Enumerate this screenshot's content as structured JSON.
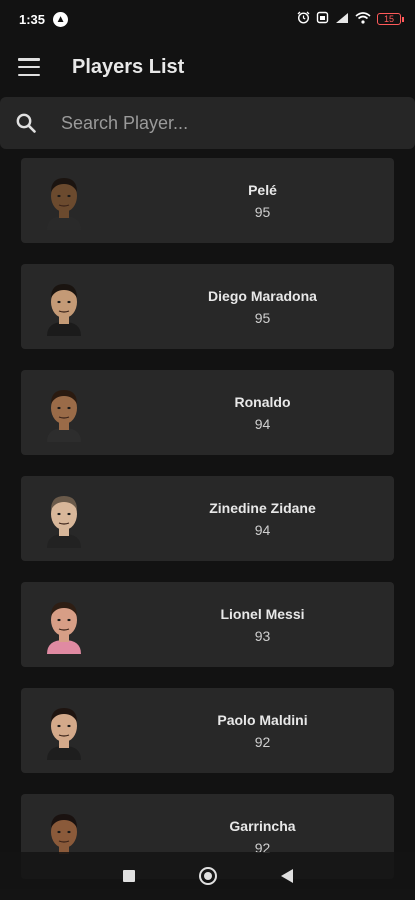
{
  "status_bar": {
    "time": "1:35",
    "battery": "15",
    "battery_color": "#ff5a5a"
  },
  "app_bar": {
    "title": "Players List",
    "menu_icon": "hamburger-menu-icon"
  },
  "search": {
    "placeholder": "Search Player...",
    "value": ""
  },
  "players": [
    {
      "name": "Pelé",
      "rating": "95",
      "skin": "#6b4a2e",
      "hair": "#1b1410",
      "shirt": "#2a2a2a"
    },
    {
      "name": "Diego Maradona",
      "rating": "95",
      "skin": "#c49a76",
      "hair": "#1a1410",
      "shirt": "#1b1b1b"
    },
    {
      "name": "Ronaldo",
      "rating": "94",
      "skin": "#9a6b48",
      "hair": "#2a1a10",
      "shirt": "#2d2d2d"
    },
    {
      "name": "Zinedine Zidane",
      "rating": "94",
      "skin": "#d8b79a",
      "hair": "#6a5a4a",
      "shirt": "#222222"
    },
    {
      "name": "Lionel Messi",
      "rating": "93",
      "skin": "#d79e86",
      "hair": "#2e1e14",
      "shirt": "#e08aa2"
    },
    {
      "name": "Paolo Maldini",
      "rating": "92",
      "skin": "#d3a98a",
      "hair": "#1e1410",
      "shirt": "#1e1e1e"
    },
    {
      "name": "Garrincha",
      "rating": "92",
      "skin": "#8a5a3a",
      "hair": "#1a1210",
      "shirt": "#2a2a2a"
    }
  ],
  "colors": {
    "background": "#121212",
    "card": "#282828",
    "search_bg": "#262626"
  }
}
